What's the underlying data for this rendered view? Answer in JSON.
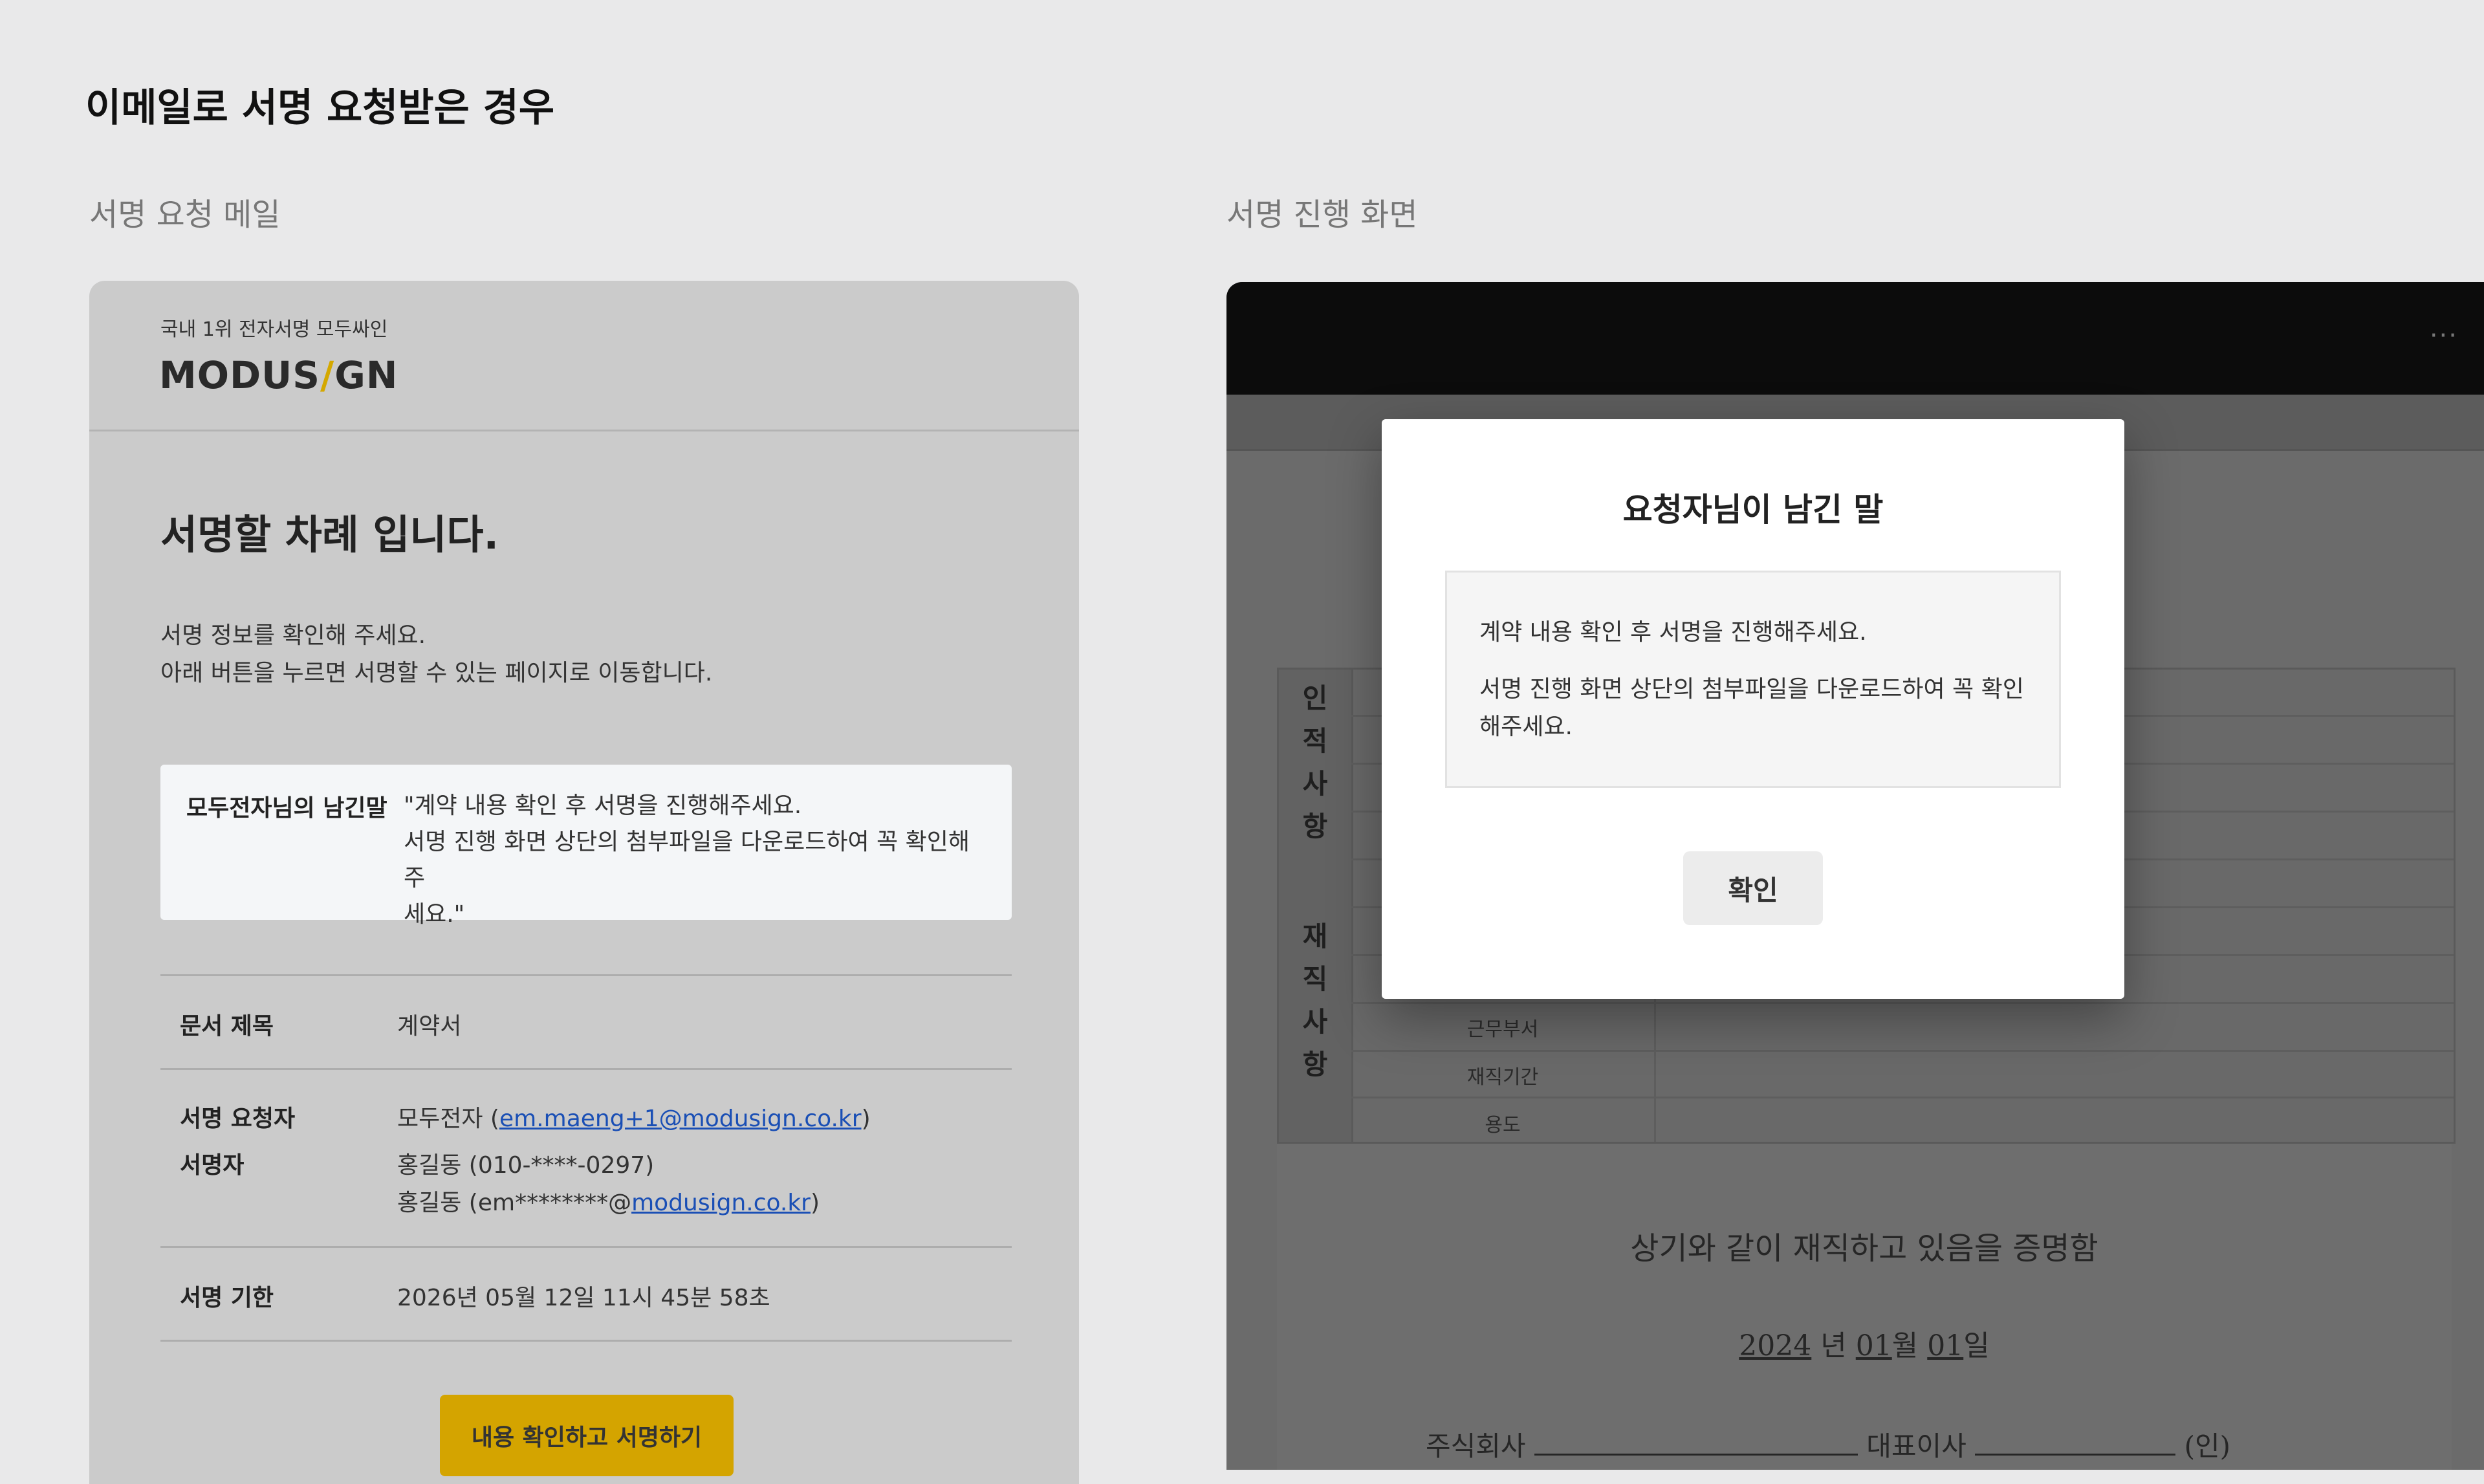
{
  "page": {
    "title": "이메일로 서명 요청받은 경우"
  },
  "sections": {
    "email_label": "서명 요청 메일",
    "sign_screen_label": "서명 진행 화면"
  },
  "email": {
    "brand_tagline": "국내 1위 전자서명 모두싸인",
    "brand_logo_left": "MODUS",
    "brand_logo_slash": "/",
    "brand_logo_right": "GN",
    "heading": "서명할 차례 입니다.",
    "intro_line1": "서명 정보를 확인해 주세요.",
    "intro_line2": "아래 버튼을 누르면 서명할 수 있는 페이지로 이동합니다.",
    "message_label": "모두전자님의 남긴말",
    "message_line1": "\"계약 내용 확인 후 서명을 진행해주세요.",
    "message_line2": "서명 진행 화면 상단의 첨부파일을 다운로드하여 꼭 확인해주",
    "message_line3": "세요.\"",
    "doc_title_label": "문서 제목",
    "doc_title_value": "계약서",
    "requester_label": "서명 요청자",
    "requester_name": "모두전자 (",
    "requester_email": "em.maeng+1@modusign.co.kr",
    "requester_close": ")",
    "signer_label": "서명자",
    "signer_phone": "홍길동 (010-****-0297)",
    "signer_email_prefix": "홍길동 (em********@",
    "signer_email_domain": "modusign.co.kr",
    "signer_email_close": ")",
    "deadline_label": "서명 기한",
    "deadline_value": "2026년 05월 12일 11시 45분 58초",
    "button_label": "내용 확인하고 서명하기"
  },
  "sign_screen": {
    "more_icon": "···",
    "doc": {
      "side_label_1": [
        "인",
        "적",
        "사",
        "항"
      ],
      "side_label_2": [
        "재",
        "직",
        "사",
        "항"
      ],
      "cell_dept": "근무부서",
      "cell_period": "재직기간",
      "cell_use": "용도",
      "statement": "상기와 같이 재직하고 있음을 증명함",
      "date_year": "2024",
      "date_year_unit": "년",
      "date_month": "01",
      "date_month_unit": "월",
      "date_day": "01",
      "date_day_unit": "일",
      "company_label": "주식회사",
      "ceo_label": "대표이사",
      "seal_label": "(인)"
    },
    "modal": {
      "title": "요청자님이 남긴 말",
      "message_line1": "계약 내용 확인 후 서명을 진행해주세요.",
      "message_line2": "서명 진행 화면 상단의 첨부파일을 다운로드하여 꼭 확인",
      "message_line3": "해주세요.",
      "confirm_label": "확인"
    }
  },
  "colors": {
    "background": "#e9e9ea",
    "brand_yellow": "#d4a400",
    "link_blue": "#1a4fb5"
  }
}
